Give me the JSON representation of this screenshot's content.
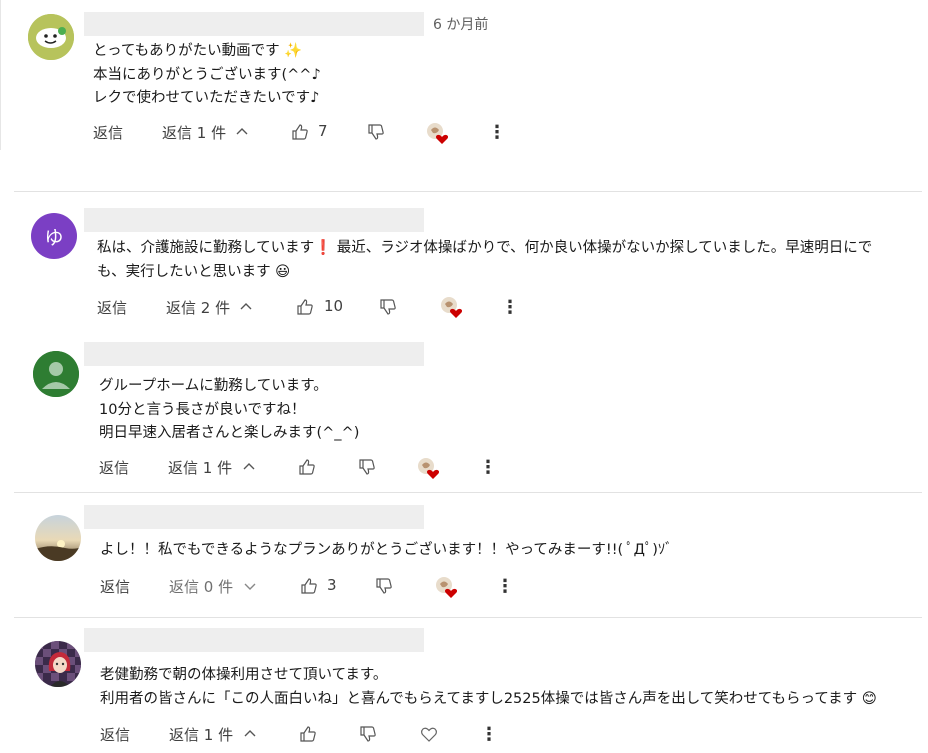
{
  "comments": [
    {
      "time": "6 か月前",
      "text": "とってもありがたい動画です ✨\n本当にありがとうございます(^^♪\nレクで使わせていただきたいです♪",
      "reply_label": "返信",
      "replies_label": "返信 1 件",
      "like_count": "7",
      "replies_chevron": "up",
      "avatar": "snowman-avatar"
    },
    {
      "avatar_letter": "ゆ",
      "text": "私は、介護施設に勤務しています❗ 最近、ラジオ体操ばかりで、何か良い体操がないか探していました。早速明日にで\nも、実行したいと思います 😃",
      "reply_label": "返信",
      "replies_label": "返信 2 件",
      "like_count": "10",
      "replies_chevron": "up",
      "avatar": "letter-avatar"
    },
    {
      "text": "グループホームに勤務しています。\n10分と言う長さが良いですね！\n明日早速入居者さんと楽しみます(^_^)",
      "reply_label": "返信",
      "replies_label": "返信 1 件",
      "like_count": "",
      "replies_chevron": "up",
      "avatar": "default-avatar"
    },
    {
      "text": "よし！！私でもできるようなプランありがとうございます！！やってみまーす!!( ﾟДﾟ)ｿﾞ",
      "reply_label": "返信",
      "replies_label": "返信 0 件",
      "like_count": "3",
      "replies_chevron": "down",
      "avatar": "sunset-avatar"
    },
    {
      "text": "老健勤務で朝の体操利用させて頂いてます。\n利用者の皆さんに「この人面白いね」と喜んでもらえてますし2525体操では皆さん声を出して笑わせてもらってます 😊",
      "reply_label": "返信",
      "replies_label": "返信 1 件",
      "like_count": "",
      "replies_chevron": "up",
      "avatar": "anime-avatar"
    }
  ],
  "colors": {
    "letter_avatar_bg": "#7b3fc4",
    "default_avatar_bg": "#2e7d32",
    "heart": "#cc0000"
  }
}
